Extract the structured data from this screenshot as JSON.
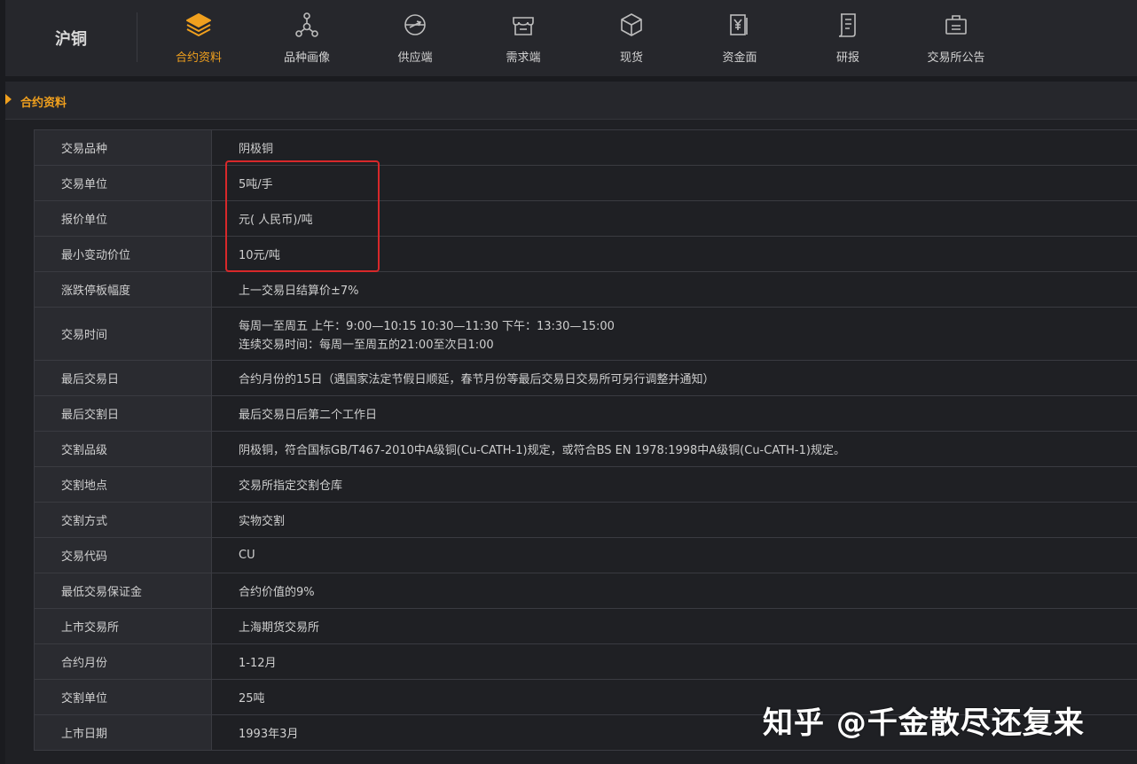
{
  "brand": "沪铜",
  "nav": [
    {
      "label": "合约资料",
      "icon": "stack-layers-icon",
      "active": true
    },
    {
      "label": "品种画像",
      "icon": "molecule-icon",
      "active": false
    },
    {
      "label": "供应端",
      "icon": "globe-plane-icon",
      "active": false
    },
    {
      "label": "需求端",
      "icon": "shop-icon",
      "active": false
    },
    {
      "label": "现货",
      "icon": "cube-icon",
      "active": false
    },
    {
      "label": "资金面",
      "icon": "yen-document-icon",
      "active": false
    },
    {
      "label": "研报",
      "icon": "report-scroll-icon",
      "active": false
    },
    {
      "label": "交易所公告",
      "icon": "briefcase-icon",
      "active": false
    }
  ],
  "section_title": "合约资料",
  "rows": [
    {
      "key": "交易品种",
      "value": "阴极铜"
    },
    {
      "key": "交易单位",
      "value": "5吨/手"
    },
    {
      "key": "报价单位",
      "value": "元( 人民币)/吨"
    },
    {
      "key": "最小变动价位",
      "value": "10元/吨"
    },
    {
      "key": "涨跌停板幅度",
      "value": "上一交易日结算价±7%"
    },
    {
      "key": "交易时间",
      "value": "每周一至周五 上午：9:00—10:15 10:30—11:30 下午：13:30—15:00",
      "value2": "连续交易时间：每周一至周五的21:00至次日1:00"
    },
    {
      "key": "最后交易日",
      "value": "合约月份的15日（遇国家法定节假日顺延，春节月份等最后交易日交易所可另行调整并通知）"
    },
    {
      "key": "最后交割日",
      "value": "最后交易日后第二个工作日"
    },
    {
      "key": "交割品级",
      "value": "阴极铜，符合国标GB/T467-2010中A级铜(Cu-CATH-1)规定，或符合BS EN 1978:1998中A级铜(Cu-CATH-1)规定。"
    },
    {
      "key": "交割地点",
      "value": "交易所指定交割仓库"
    },
    {
      "key": "交割方式",
      "value": "实物交割"
    },
    {
      "key": "交易代码",
      "value": "CU"
    },
    {
      "key": "最低交易保证金",
      "value": "合约价值的9%"
    },
    {
      "key": "上市交易所",
      "value": "上海期货交易所"
    },
    {
      "key": "合约月份",
      "value": "1-12月"
    },
    {
      "key": "交割单位",
      "value": "25吨"
    },
    {
      "key": "上市日期",
      "value": "1993年3月"
    }
  ],
  "watermark": "知乎 @千金散尽还复来",
  "colors": {
    "accent": "#f0a01e",
    "highlight": "#d8282a",
    "background": "#1a1b1f"
  }
}
